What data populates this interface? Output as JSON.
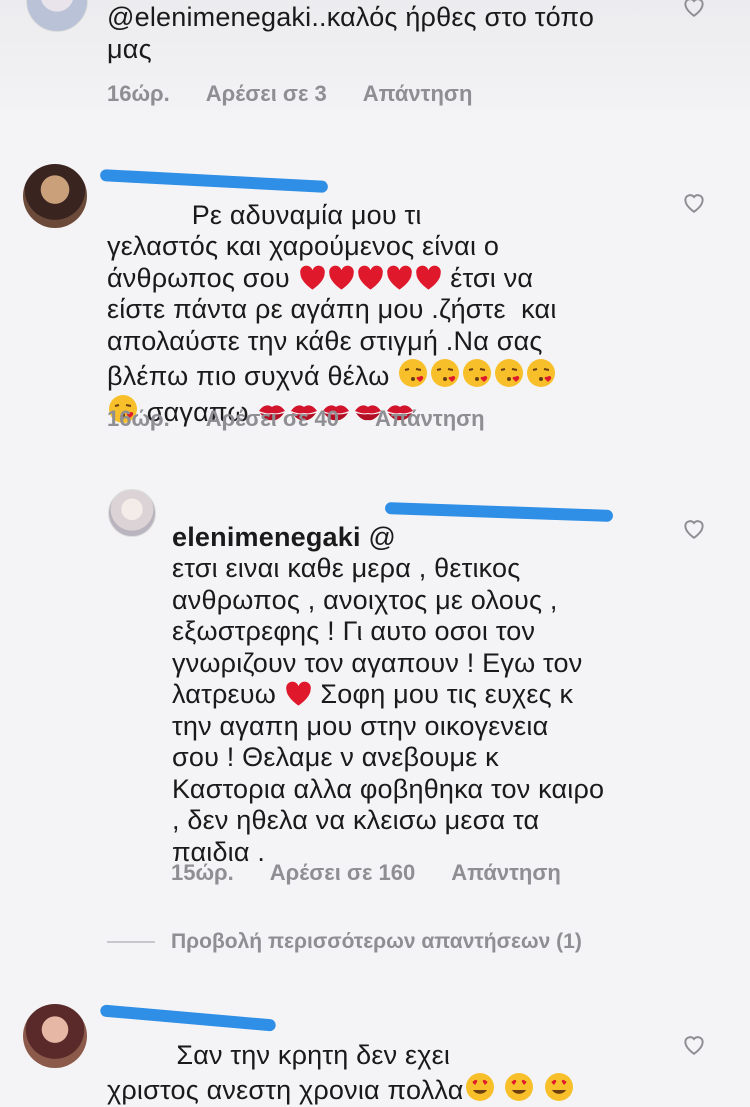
{
  "comments": [
    {
      "text": "@elenimenegaki..καλός ήρθες στο τόπο\nμας",
      "time": "16ώρ.",
      "likes": "Αρέσει σε 3",
      "reply": "Απάντηση"
    },
    {
      "text_a": "           Ρε αδυναμία μου τι\nγελαστός και χαρούμενος είναι ο\nάνθρωπος σου ",
      "text_b": " έτσι να\nείστε πάντα ρε αγάπη μου .ζήστε  και\nαπολαύστε την κάθε στιγμή .Να σας\nβλέπω πιο συχνά θέλω ",
      "text_c": "\n",
      "text_d": " σαγαπω ",
      "time": "16ώρ.",
      "likes": "Αρέσει σε 40",
      "reply": "Απάντηση"
    },
    {
      "username": "elenimenegaki",
      "mention": "@",
      "text_a": "ετσι ειναι καθε μερα , θετικος\nανθρωπος , ανοιχτος με ολους ,\nεξωστρεφης ! Γι αυτο οσοι τον\nγνωριζουν τον αγαπουν ! Εγω τον\nλατρευω ",
      "text_b": " Σοφη μου τις ευχες κ\nτην αγαπη μου στην οικογενεια\nσου ! Θελαμε ν ανεβουμε κ\nΚαστορια αλλα φοβηθηκα τον καιρο\n, δεν ηθελα να κλεισω μεσα τα\nπαιδια .",
      "time": "15ώρ.",
      "likes": "Αρέσει σε 160",
      "reply": "Απάντηση"
    },
    {
      "text_a": "         Σαν την κρητη δεν εχει\nχριστος ανεστη χρονια πολλα"
    }
  ],
  "more_replies": "Προβολή περισσότερων απαντήσεων (1)",
  "colors": {
    "redaction": "#2f8ee6",
    "meta": "#8e8e93",
    "heart": "#e0182c"
  }
}
